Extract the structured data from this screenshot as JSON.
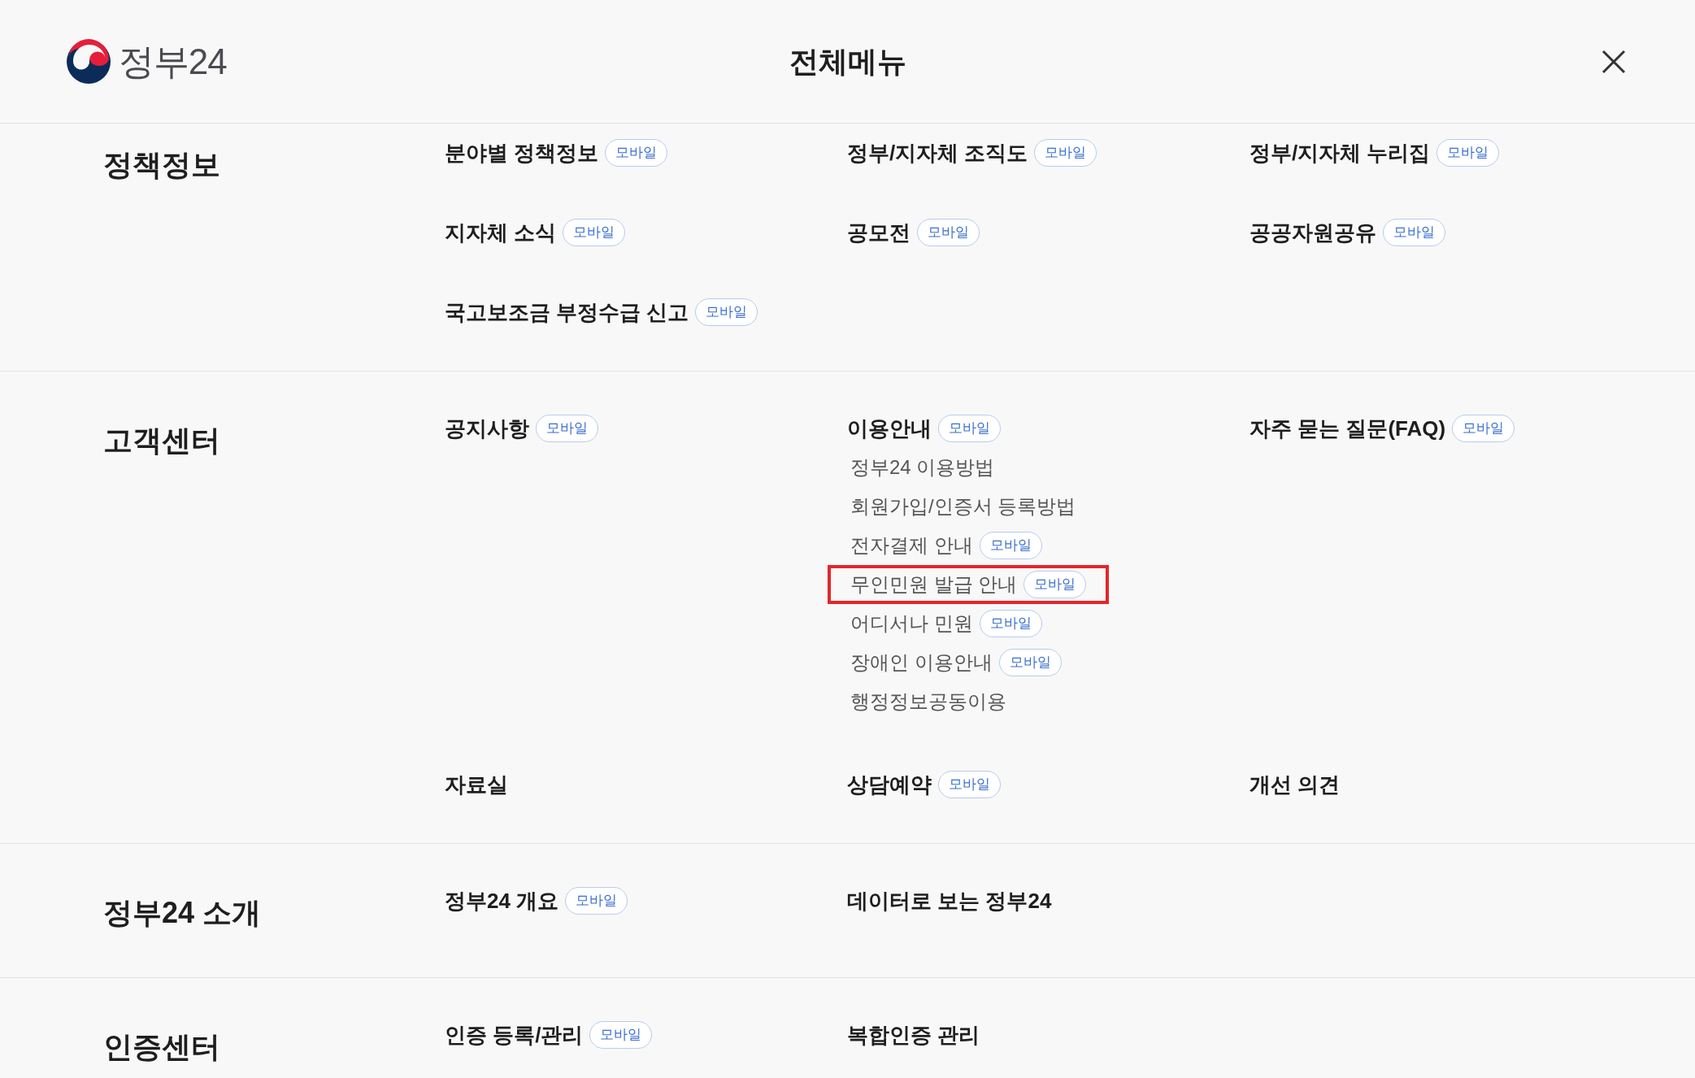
{
  "header": {
    "logo_text": "정부24",
    "title": "전체메뉴"
  },
  "sections": [
    {
      "title": "정책정보",
      "items": [
        {
          "label": "분야별 정책정보",
          "badge": "모바일"
        },
        {
          "label": "정부/지자체 조직도",
          "badge": "모바일"
        },
        {
          "label": "정부/지자체 누리집",
          "badge": "모바일"
        },
        {
          "label": "지자체 소식",
          "badge": "모바일"
        },
        {
          "label": "공모전",
          "badge": "모바일"
        },
        {
          "label": "공공자원공유",
          "badge": "모바일"
        },
        {
          "label": "국고보조금 부정수급 신고",
          "badge": "모바일"
        }
      ]
    },
    {
      "title": "고객센터",
      "items": [
        {
          "label": "공지사항",
          "badge": "모바일"
        },
        {
          "label": "이용안내",
          "badge": "모바일",
          "children": [
            {
              "label": "정부24 이용방법",
              "highlighted": false
            },
            {
              "label": "회원가입/인증서 등록방법",
              "highlighted": false
            },
            {
              "label": "전자결제 안내",
              "badge": "모바일",
              "highlighted": false
            },
            {
              "label": "무인민원 발급 안내",
              "badge": "모바일",
              "highlighted": true
            },
            {
              "label": "어디서나 민원",
              "badge": "모바일",
              "highlighted": false
            },
            {
              "label": "장애인 이용안내",
              "badge": "모바일",
              "highlighted": false
            },
            {
              "label": "행정정보공동이용",
              "highlighted": false
            }
          ]
        },
        {
          "label": "자주 묻는 질문(FAQ)",
          "badge": "모바일"
        },
        {
          "label": "자료실"
        },
        {
          "label": "상담예약",
          "badge": "모바일"
        },
        {
          "label": "개선 의견"
        }
      ]
    },
    {
      "title": "정부24 소개",
      "items": [
        {
          "label": "정부24 개요",
          "badge": "모바일"
        },
        {
          "label": "데이터로 보는 정부24"
        }
      ]
    },
    {
      "title": "인증센터",
      "items": [
        {
          "label": "인증 등록/관리",
          "badge": "모바일"
        },
        {
          "label": "복합인증 관리"
        }
      ]
    }
  ]
}
